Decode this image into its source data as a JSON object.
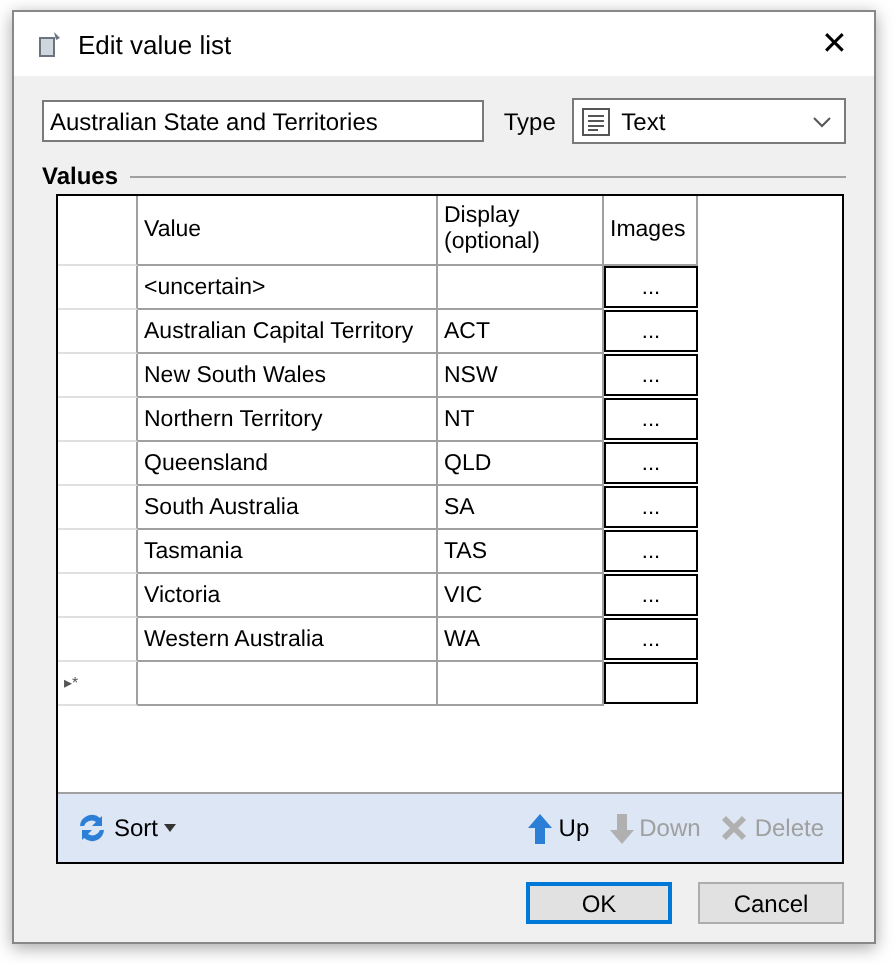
{
  "window": {
    "title": "Edit value list",
    "close": "✕"
  },
  "name_field": {
    "value": "Australian State and Territories"
  },
  "type": {
    "label": "Type",
    "value": "Text"
  },
  "values_label": "Values",
  "table": {
    "columns": [
      "Value",
      "Display\n(optional)",
      "Images"
    ],
    "rows": [
      {
        "value": "<uncertain>",
        "display": "",
        "images": "..."
      },
      {
        "value": "Australian Capital Territory",
        "display": "ACT",
        "images": "..."
      },
      {
        "value": "New South Wales",
        "display": "NSW",
        "images": "..."
      },
      {
        "value": "Northern Territory",
        "display": "NT",
        "images": "..."
      },
      {
        "value": "Queensland",
        "display": "QLD",
        "images": "..."
      },
      {
        "value": "South Australia",
        "display": "SA",
        "images": "..."
      },
      {
        "value": "Tasmania",
        "display": "TAS",
        "images": "..."
      },
      {
        "value": "Victoria",
        "display": "VIC",
        "images": "..."
      },
      {
        "value": "Western Australia",
        "display": "WA",
        "images": "..."
      }
    ],
    "new_row_marker": "▸*"
  },
  "toolbar": [
    {
      "kind": "sort",
      "label": "Sort",
      "disabled": false
    },
    {
      "kind": "up",
      "label": "Up",
      "disabled": false
    },
    {
      "kind": "down",
      "label": "Down",
      "disabled": true
    },
    {
      "kind": "delete",
      "label": "Delete",
      "disabled": true
    }
  ],
  "buttons": [
    {
      "label": "OK",
      "default": true
    },
    {
      "label": "Cancel",
      "default": false
    }
  ]
}
